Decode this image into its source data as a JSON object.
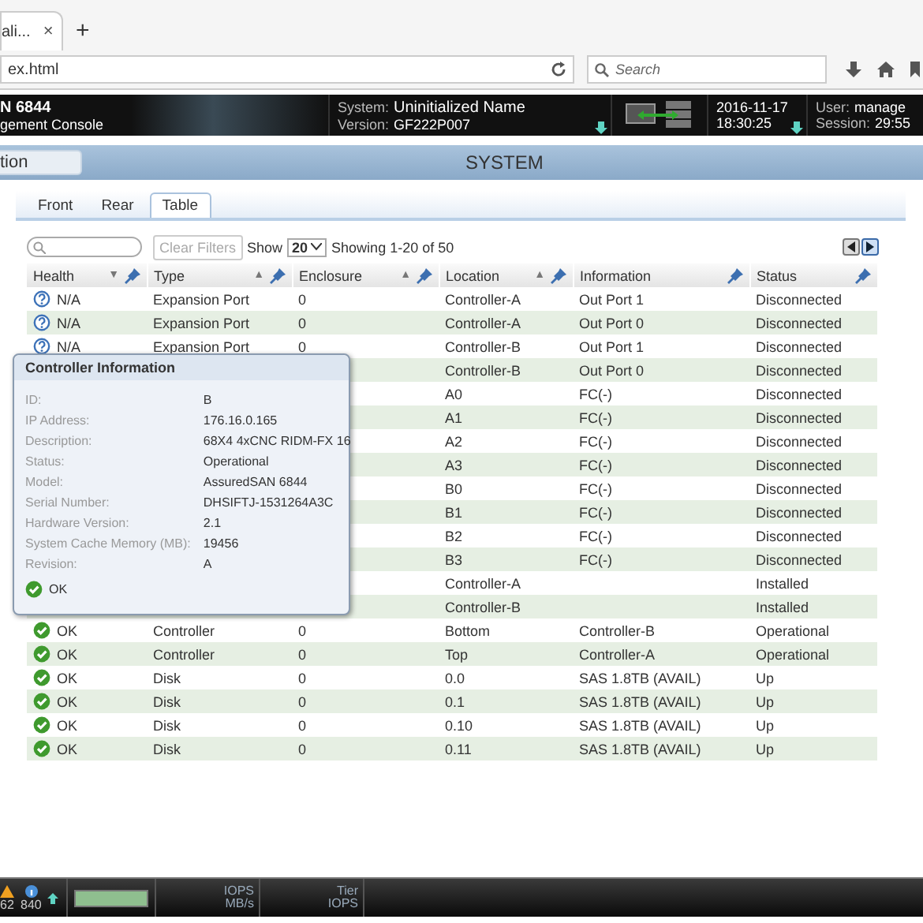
{
  "browser": {
    "tab": {
      "title": "ali...",
      "close": "×",
      "selected": true
    },
    "new_tab": "+",
    "address": "ex.html",
    "search": {
      "placeholder": "Search"
    }
  },
  "header": {
    "product": "N 6844",
    "subtitle": "gement Console",
    "system_label": "System:",
    "system": "Uninitialized Name",
    "version_label": "Version:",
    "version": "GF222P007",
    "date": "2016-11-17",
    "time": "18:30:25",
    "user_label": "User:",
    "user": "manage",
    "session_label": "Session:",
    "session": "29:55"
  },
  "nav": {
    "button": "tion",
    "title": "SYSTEM"
  },
  "tabs": [
    {
      "label": "Front",
      "selected": false
    },
    {
      "label": "Rear",
      "selected": false
    },
    {
      "label": "Table",
      "selected": true
    }
  ],
  "toolbar": {
    "clear_filters": {
      "label": "Clear Filters",
      "disabled": true
    },
    "show_label": "Show",
    "page_size": "20",
    "showing": "Showing 1-20 of 50",
    "prev": {
      "disabled": true
    },
    "next": {
      "disabled": false
    }
  },
  "table": {
    "columns": [
      {
        "label": "Health",
        "sort": "▼"
      },
      {
        "label": "Type",
        "sort": "▲"
      },
      {
        "label": "Enclosure",
        "sort": "▲"
      },
      {
        "label": "Location",
        "sort": "▲"
      },
      {
        "label": "Information"
      },
      {
        "label": "Status"
      }
    ],
    "rows": [
      {
        "health": {
          "kind": "unknown",
          "text": "N/A"
        },
        "type": "Expansion Port",
        "enclosure": "0",
        "location": "Controller-A",
        "information": "Out Port 1",
        "status": "Disconnected"
      },
      {
        "health": {
          "kind": "unknown",
          "text": "N/A"
        },
        "type": "Expansion Port",
        "enclosure": "0",
        "location": "Controller-A",
        "information": "Out Port 0",
        "status": "Disconnected"
      },
      {
        "health": {
          "kind": "unknown",
          "text": "N/A"
        },
        "type": "Expansion Port",
        "enclosure": "0",
        "location": "Controller-B",
        "information": "Out Port 1",
        "status": "Disconnected"
      },
      {
        "location": "Controller-B",
        "information": "Out Port 0",
        "status": "Disconnected"
      },
      {
        "location": "A0",
        "information": "FC(-)",
        "status": "Disconnected"
      },
      {
        "location": "A1",
        "information": "FC(-)",
        "status": "Disconnected"
      },
      {
        "location": "A2",
        "information": "FC(-)",
        "status": "Disconnected"
      },
      {
        "location": "A3",
        "information": "FC(-)",
        "status": "Disconnected"
      },
      {
        "location": "B0",
        "information": "FC(-)",
        "status": "Disconnected"
      },
      {
        "location": "B1",
        "information": "FC(-)",
        "status": "Disconnected"
      },
      {
        "location": "B2",
        "information": "FC(-)",
        "status": "Disconnected"
      },
      {
        "location": "B3",
        "information": "FC(-)",
        "status": "Disconnected"
      },
      {
        "location": "Controller-A",
        "status": "Installed"
      },
      {
        "location": "Controller-B",
        "status": "Installed"
      },
      {
        "health": {
          "kind": "ok",
          "text": "OK"
        },
        "type": "Controller",
        "enclosure": "0",
        "location": "Bottom",
        "information": "Controller-B",
        "status": "Operational"
      },
      {
        "health": {
          "kind": "ok",
          "text": "OK"
        },
        "type": "Controller",
        "enclosure": "0",
        "location": "Top",
        "information": "Controller-A",
        "status": "Operational"
      },
      {
        "health": {
          "kind": "ok",
          "text": "OK"
        },
        "type": "Disk",
        "enclosure": "0",
        "location": "0.0",
        "information": "SAS 1.8TB (AVAIL)",
        "status": "Up"
      },
      {
        "health": {
          "kind": "ok",
          "text": "OK"
        },
        "type": "Disk",
        "enclosure": "0",
        "location": "0.1",
        "information": "SAS 1.8TB (AVAIL)",
        "status": "Up"
      },
      {
        "health": {
          "kind": "ok",
          "text": "OK"
        },
        "type": "Disk",
        "enclosure": "0",
        "location": "0.10",
        "information": "SAS 1.8TB (AVAIL)",
        "status": "Up"
      },
      {
        "health": {
          "kind": "ok",
          "text": "OK"
        },
        "type": "Disk",
        "enclosure": "0",
        "location": "0.11",
        "information": "SAS 1.8TB (AVAIL)",
        "status": "Up"
      }
    ]
  },
  "popup": {
    "title": "Controller Information",
    "fields": [
      {
        "label": "ID:",
        "value": "B"
      },
      {
        "label": "IP Address:",
        "value": "176.16.0.165"
      },
      {
        "label": "Description:",
        "value": "68X4 4xCNC RIDM-FX 16"
      },
      {
        "label": "Status:",
        "value": "Operational"
      },
      {
        "label": "Model:",
        "value": "AssuredSAN 6844"
      },
      {
        "label": "Serial Number:",
        "value": "DHSIFTJ-1531264A3C"
      },
      {
        "label": "Hardware Version:",
        "value": "2.1"
      },
      {
        "label": "System Cache Memory (MB):",
        "value": "19456"
      },
      {
        "label": "Revision:",
        "value": "A"
      }
    ],
    "health": {
      "kind": "ok",
      "text": "OK"
    }
  },
  "status_bar": {
    "warnings": "62",
    "info": "840",
    "perf_1": [
      "IOPS",
      "MB/s"
    ],
    "perf_2": [
      "Tier",
      "IOPS"
    ]
  }
}
